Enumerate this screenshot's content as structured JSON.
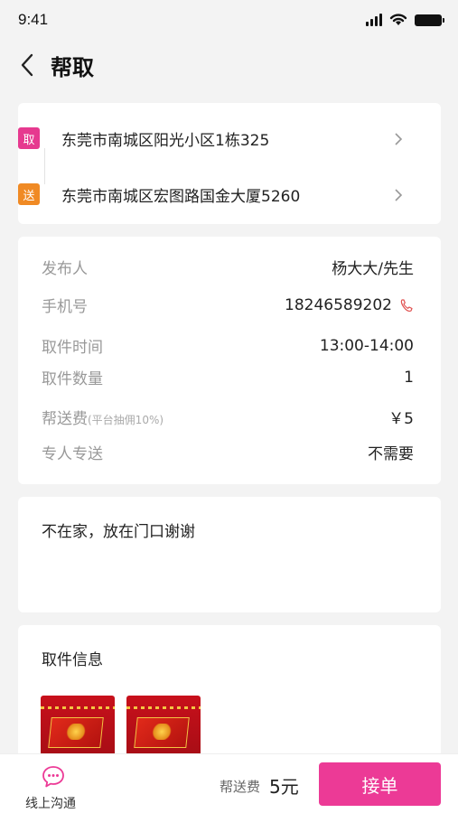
{
  "status": {
    "time": "9:41"
  },
  "nav": {
    "title": "帮取"
  },
  "route": {
    "pickup": {
      "tag": "取",
      "tag_color": "#e6398f",
      "address": "东莞市南城区阳光小区1栋325"
    },
    "dropoff": {
      "tag": "送",
      "tag_color": "#f08a24",
      "address": "东莞市南城区宏图路国金大厦5260"
    }
  },
  "info": {
    "publisher": {
      "label": "发布人",
      "value": "杨大大/先生"
    },
    "phone": {
      "label": "手机号",
      "value": "18246589202"
    },
    "pickup_time": {
      "label": "取件时间",
      "value": "13:00-14:00"
    },
    "quantity": {
      "label": "取件数量",
      "value": "1"
    },
    "fee": {
      "label": "帮送费",
      "note": "(平台抽佣10%)",
      "value": "￥5"
    },
    "dedicated": {
      "label": "专人专送",
      "value": "不需要"
    }
  },
  "note": {
    "text": "不在家，放在门口谢谢"
  },
  "pickup_info": {
    "title": "取件信息",
    "images": [
      "product-photo",
      "product-photo"
    ]
  },
  "bottom": {
    "chat_label": "线上沟通",
    "fee_label": "帮送费",
    "fee_value": "5元",
    "accept_label": "接单",
    "accent_color": "#ec3a96"
  }
}
